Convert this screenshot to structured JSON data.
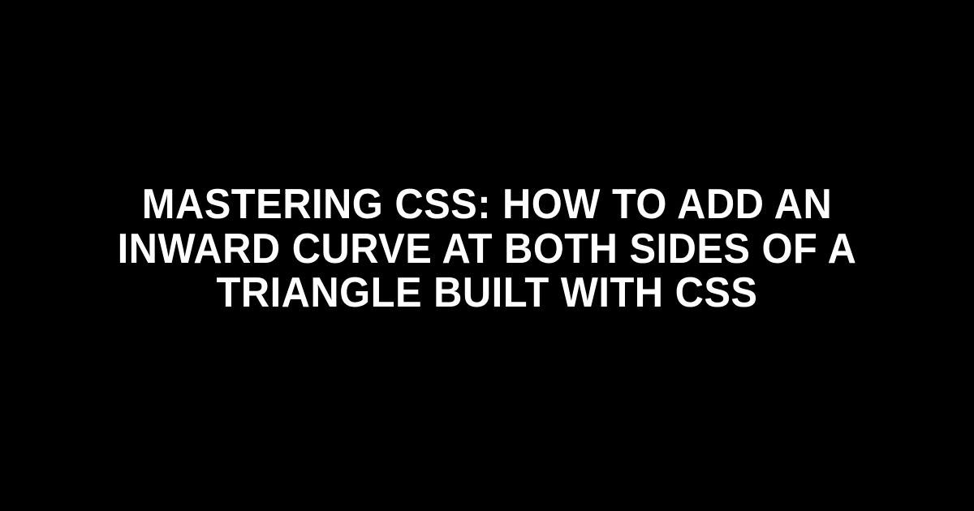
{
  "headline": {
    "text": "Mastering CSS: How to Add an Inward Curve at Both Sides of a Triangle Built with CSS"
  },
  "colors": {
    "background": "#000000",
    "text": "#ffffff"
  }
}
